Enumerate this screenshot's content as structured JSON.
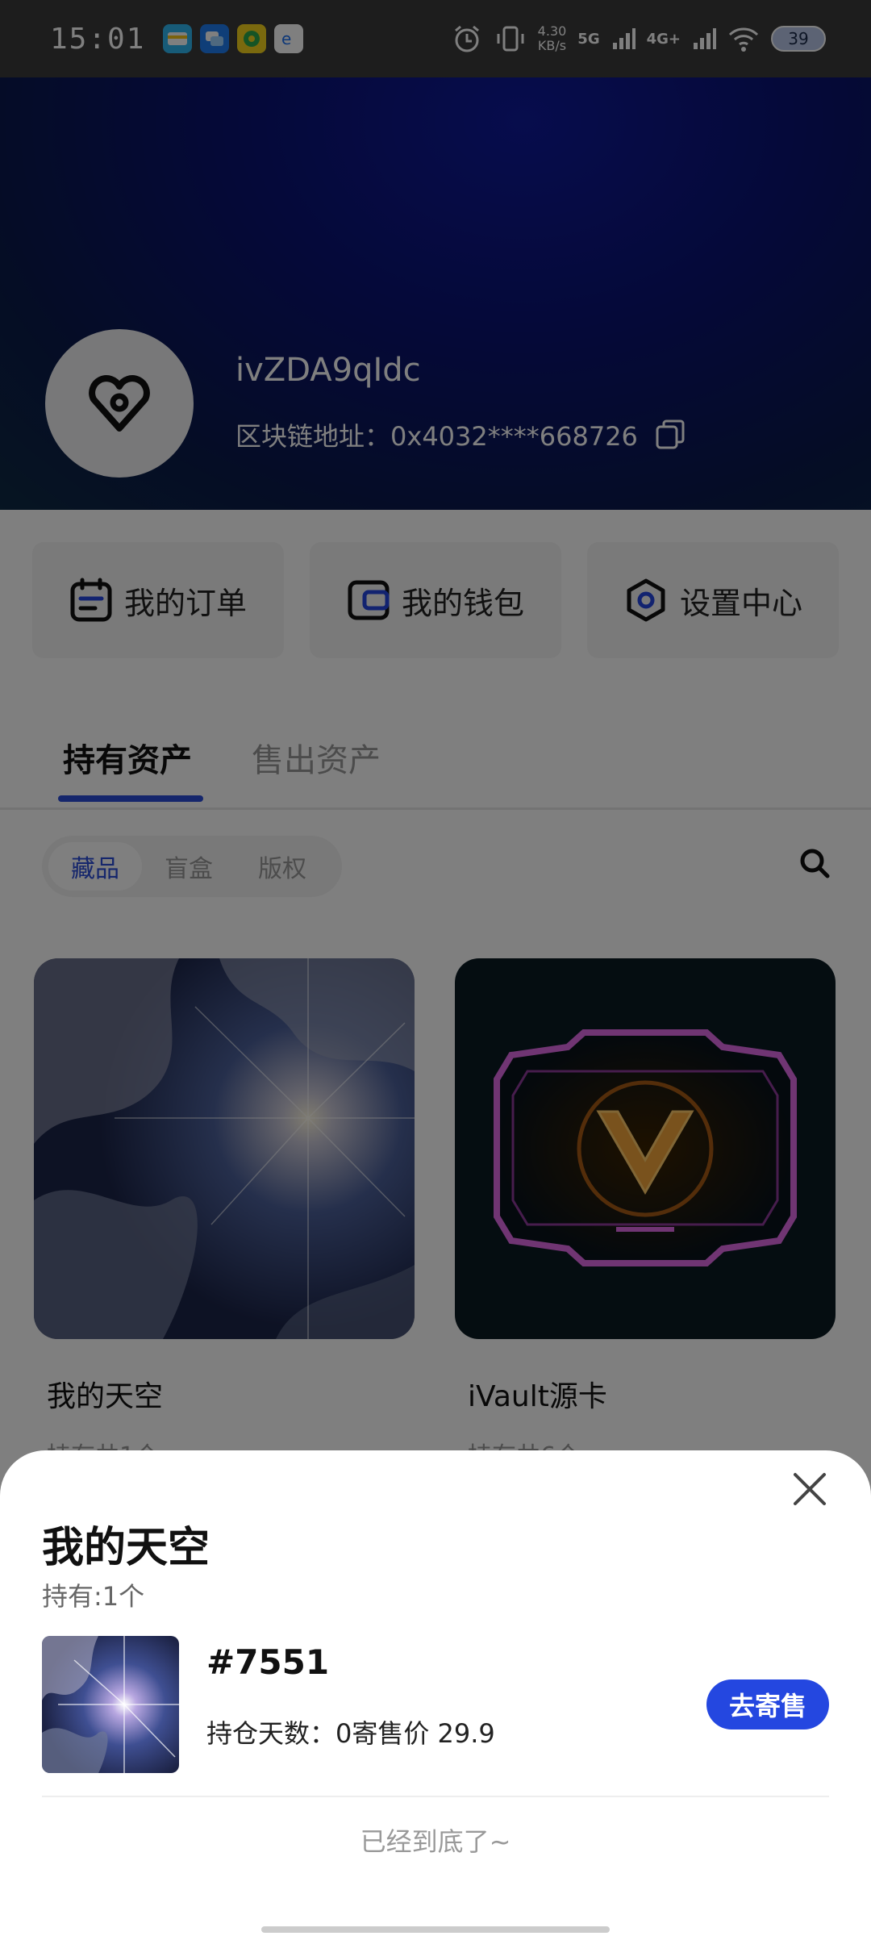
{
  "status_bar": {
    "time": "15:01",
    "speed_value": "4.30",
    "speed_unit": "KB/s",
    "network_5g": "5G",
    "network_4g": "4G+",
    "battery": "39"
  },
  "profile": {
    "username": "ivZDA9qIdc",
    "chain_address_label": "区块链地址：",
    "chain_address": "0x4032****668726"
  },
  "actions": [
    {
      "label": "我的订单",
      "icon": "calendar-icon"
    },
    {
      "label": "我的钱包",
      "icon": "wallet-icon"
    },
    {
      "label": "设置中心",
      "icon": "settings-hexagon-icon"
    }
  ],
  "tabs": [
    {
      "label": "持有资产",
      "active": true
    },
    {
      "label": "售出资产",
      "active": false
    }
  ],
  "filters": [
    {
      "label": "藏品",
      "active": true
    },
    {
      "label": "盲盒",
      "active": false
    },
    {
      "label": "版权",
      "active": false
    }
  ],
  "collections": [
    {
      "title": "我的天空",
      "subtitle": "持有共1个"
    },
    {
      "title": "iVault源卡",
      "subtitle": "持有共6个"
    }
  ],
  "sheet": {
    "title": "我的天空",
    "hold": "持有:1个",
    "item_id": "#7551",
    "item_meta": "持仓天数：0寄售价 29.9",
    "consign_button": "去寄售",
    "bottom_text": "已经到底了~"
  },
  "colors": {
    "accent": "#2447e0",
    "banner_dark": "#0a1270"
  }
}
